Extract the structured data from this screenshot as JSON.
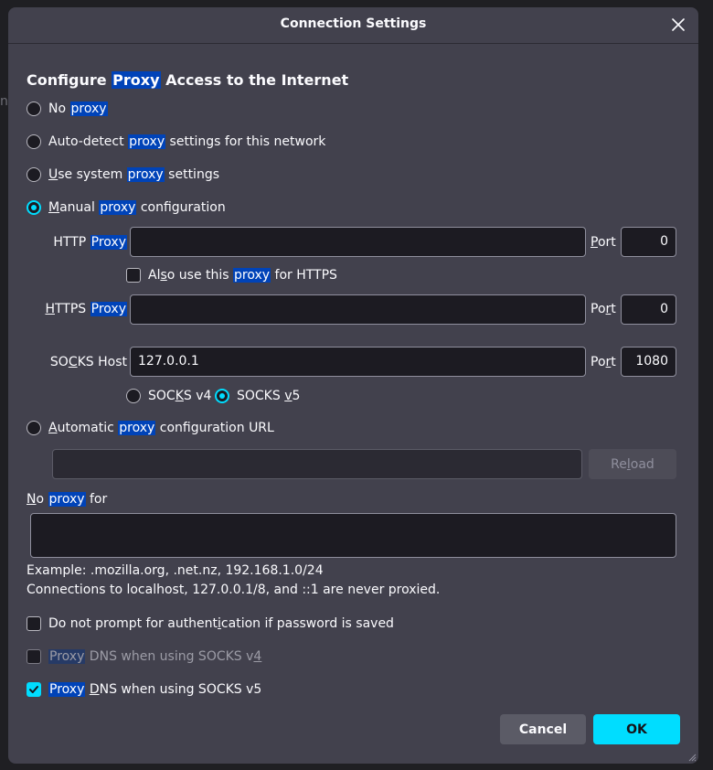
{
  "background_fragment": "n",
  "dialog": {
    "title": "Connection Settings"
  },
  "heading": {
    "pre": "Configure ",
    "hl": "Proxy",
    "post": " Access to the Internet"
  },
  "options": {
    "no_proxy": {
      "a": "No ",
      "hl": "proxy",
      "selected": false
    },
    "auto_detect": {
      "a": "Auto-detect ",
      "hl": "proxy",
      "b": " settings for this network",
      "selected": false
    },
    "system": {
      "a": "U",
      "b": "se system ",
      "hl": "proxy",
      "c": " settings",
      "selected": false
    },
    "manual": {
      "a": "M",
      "b": "anual ",
      "hl": "proxy",
      "c": " configuration",
      "selected": true
    },
    "auto_url": {
      "a": "A",
      "b": "utomatic ",
      "hl": "proxy",
      "c": " configuration URL",
      "selected": false
    }
  },
  "http": {
    "label_a": "HTTP ",
    "label_hl": "Proxy",
    "value": "",
    "port_label_u": "P",
    "port_label_rest": "ort",
    "port": "0"
  },
  "also_https": {
    "a": "Al",
    "u": "s",
    "b": "o use this ",
    "hl": "proxy",
    "c": " for HTTPS",
    "checked": false
  },
  "https": {
    "label_u": "H",
    "label_rest": "TTPS ",
    "label_hl": "Proxy",
    "value": "",
    "port_label_a": "Po",
    "port_label_u": "r",
    "port_label_rest": "t",
    "port": "0"
  },
  "socks": {
    "label_a": "SO",
    "label_u": "C",
    "label_rest": "KS Host",
    "value": "127.0.0.1",
    "port_label_a": "Po",
    "port_label_u": "r",
    "port_label_rest": "t",
    "port": "1080"
  },
  "socks_version": {
    "v4": {
      "a": "SOC",
      "u": "K",
      "b": "S v4",
      "selected": false
    },
    "v5": {
      "a": "SOCKS ",
      "u": "v",
      "b": "5",
      "selected": true
    }
  },
  "auto_url_value": "",
  "reload": {
    "a": "Re",
    "u": "l",
    "b": "oad"
  },
  "no_proxy_for": {
    "u": "N",
    "a": "o ",
    "hl": "proxy",
    "b": " for",
    "value": ""
  },
  "example": "Example: .mozilla.org, .net.nz, 192.168.1.0/24",
  "localhost_note": "Connections to localhost, 127.0.0.1/8, and ::1 are never proxied.",
  "checks": {
    "no_prompt": {
      "a": "Do not prompt for authent",
      "u": "i",
      "b": "cation if password is saved",
      "checked": false
    },
    "dns_v4": {
      "hl": "Proxy",
      "a": " DNS when using SOCKS v",
      "u": "4",
      "checked": false
    },
    "dns_v5": {
      "hl": "Proxy",
      "a": " ",
      "u": "D",
      "b": "NS when using SOCKS v5",
      "checked": true
    }
  },
  "buttons": {
    "cancel": "Cancel",
    "ok": "OK"
  },
  "colors": {
    "accent": "#00ddff",
    "highlight": "#0043b8",
    "dialog_bg": "#42414d",
    "field_bg": "#1c1b22"
  }
}
